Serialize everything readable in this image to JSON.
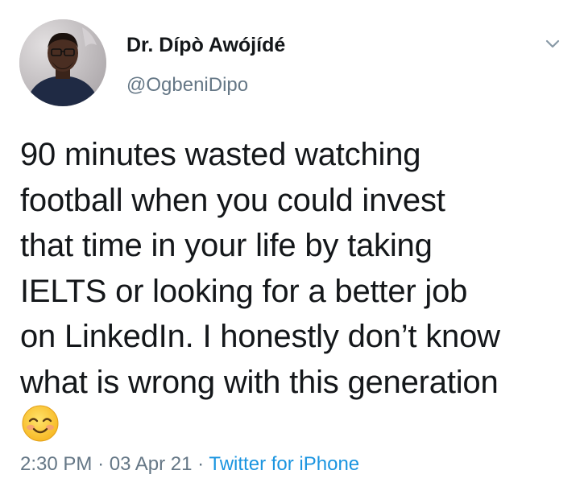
{
  "author": {
    "display_name": "Dr. Dípò Awójídé",
    "handle": "@OgbeniDipo"
  },
  "tweet": {
    "lines": [
      "90 minutes wasted watching",
      "football when you could invest",
      "that time in your life by taking",
      "IELTS or looking for a better job",
      "on LinkedIn. I honestly don’t know",
      "what is wrong with this generation"
    ],
    "emoji": "smiling-face-with-smiling-eyes"
  },
  "meta": {
    "time": "2:30 PM",
    "separator": "·",
    "date": "03 Apr 21",
    "source": "Twitter for iPhone"
  },
  "colors": {
    "text": "#14171a",
    "secondary": "#657786",
    "link": "#1b95e0"
  }
}
